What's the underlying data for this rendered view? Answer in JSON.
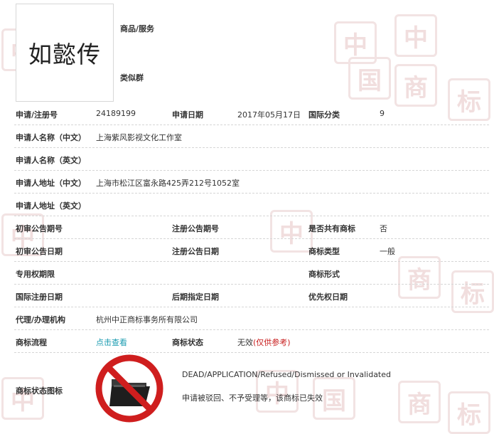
{
  "mark": {
    "name": "如懿传",
    "goods_label": "商品/服务",
    "class_group_label": "类似群"
  },
  "fields": {
    "reg_no_label": "申请/注册号",
    "reg_no": "24189199",
    "apply_date_label": "申请日期",
    "apply_date": "2017年05月17日",
    "intl_class_label": "国际分类",
    "intl_class": "9",
    "applicant_cn_label": "申请人名称（中文）",
    "applicant_cn": "上海紫风影视文化工作室",
    "applicant_en_label": "申请人名称（英文）",
    "address_cn_label": "申请人地址（中文）",
    "address_cn": "上海市松江区富永路425弄212号1052室",
    "address_en_label": "申请人地址（英文）",
    "prelim_pub_no_label": "初审公告期号",
    "reg_pub_no_label": "注册公告期号",
    "shared_label": "是否共有商标",
    "shared": "否",
    "prelim_pub_date_label": "初审公告日期",
    "reg_pub_date_label": "注册公告日期",
    "mark_type_label": "商标类型",
    "mark_type": "一般",
    "exclusive_period_label": "专用权期限",
    "mark_form_label": "商标形式",
    "intl_reg_date_label": "国际注册日期",
    "later_designation_label": "后期指定日期",
    "priority_date_label": "优先权日期",
    "agent_label": "代理/办理机构",
    "agent": "杭州中正商标事务所有限公司",
    "process_label": "商标流程",
    "process_link": "点击查看",
    "status_label": "商标状态",
    "status_value": "无效",
    "status_note": "(仅供参考)",
    "status_icon_label": "商标状态图标"
  },
  "status_block": {
    "english": "DEAD/APPLICATION/Refused/Dismissed or Invalidated",
    "chinese": "申请被驳回、不予受理等，该商标已失效"
  },
  "watermark": [
    "中",
    "国",
    "商",
    "标"
  ],
  "colors": {
    "link": "#1a9bb0",
    "warning_red": "#c81e1e",
    "label_text": "#333333"
  }
}
